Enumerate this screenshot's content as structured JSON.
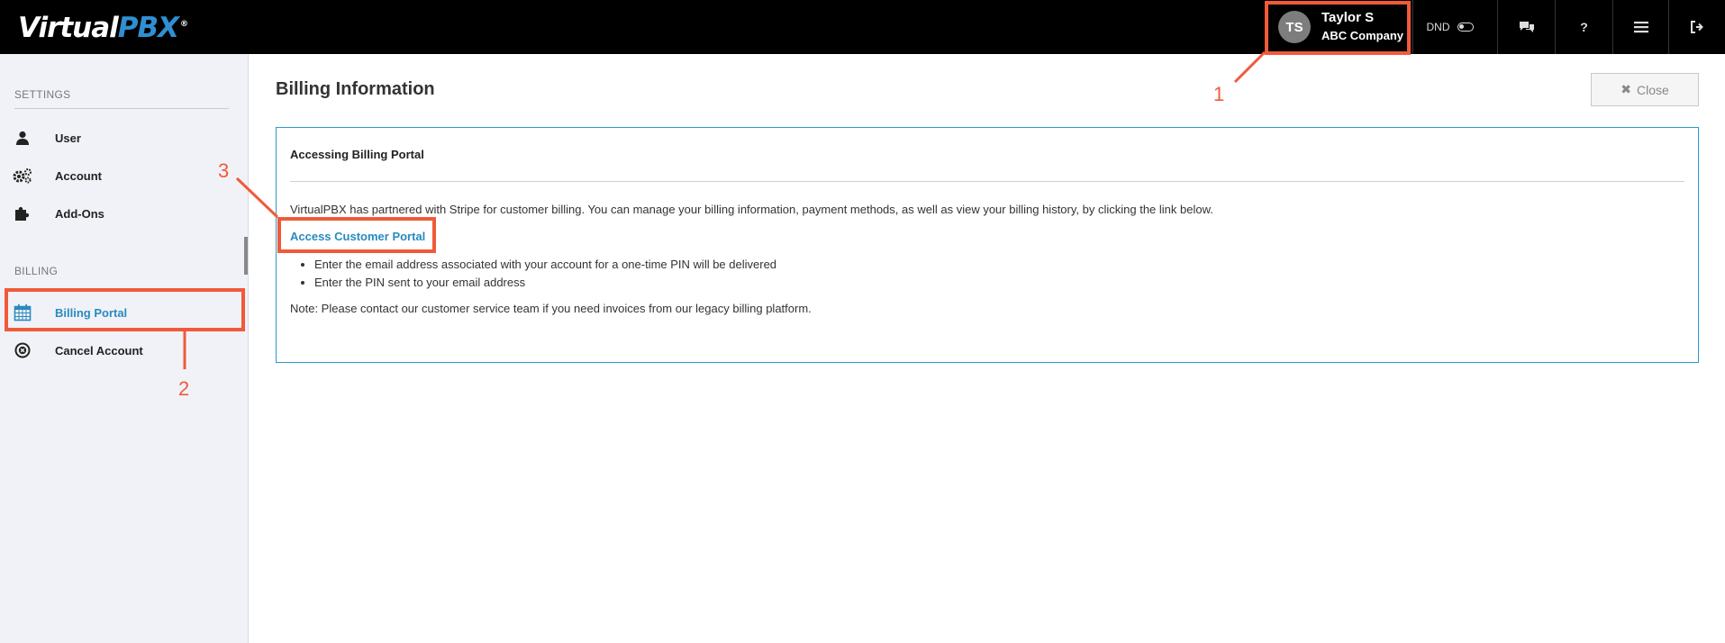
{
  "header": {
    "logo": {
      "part1": "Virtual",
      "part2": "PBX",
      "reg": "®"
    },
    "user": {
      "initials": "TS",
      "name": "Taylor S",
      "company": "ABC Company"
    },
    "dnd_label": "DND"
  },
  "sidebar": {
    "settings_title": "SETTINGS",
    "settings_items": [
      {
        "label": "User",
        "icon": "user-icon"
      },
      {
        "label": "Account",
        "icon": "gears-icon"
      },
      {
        "label": "Add-Ons",
        "icon": "puzzle-icon"
      }
    ],
    "billing_title": "BILLING",
    "billing_items": [
      {
        "label": "Billing Portal",
        "icon": "calendar-icon",
        "active": true
      },
      {
        "label": "Cancel Account",
        "icon": "cancel-circle-icon"
      }
    ]
  },
  "main": {
    "title": "Billing Information",
    "close_label": "Close",
    "panel": {
      "title": "Accessing Billing Portal",
      "description": "VirtualPBX has partnered with Stripe for customer billing. You can manage your billing information, payment methods, as well as view your billing history, by clicking the link below.",
      "link_label": "Access Customer Portal",
      "steps": [
        "Enter the email address associated with your account for a one-time PIN will be delivered",
        "Enter the PIN sent to your email address"
      ],
      "note": "Note: Please contact our customer service team if you need invoices from our legacy billing platform."
    }
  },
  "annotations": {
    "n1": "1",
    "n2": "2",
    "n3": "3",
    "color": "#f05a3a"
  },
  "colors": {
    "accent": "#2a8ac0",
    "panel_border": "#2a9bc9",
    "topbar": "#000000"
  }
}
